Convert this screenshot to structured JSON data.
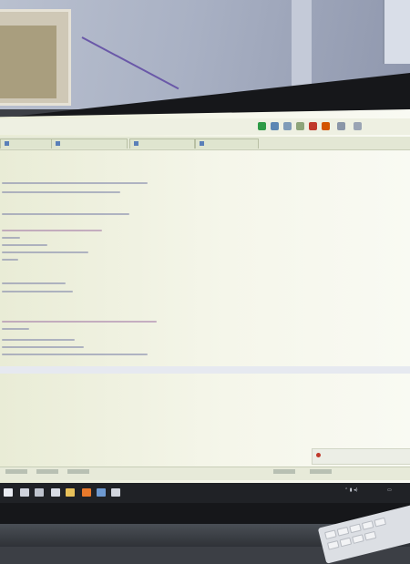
{
  "scene": {
    "description_colors": {
      "screen": "#f3f5e6",
      "bezel": "#16171a",
      "wall": "#aab2c5",
      "taskbar": "#202226"
    }
  },
  "editor": {
    "tabs": [
      {
        "icon": "java-file-icon"
      },
      {
        "icon": "java-file-icon"
      },
      {
        "icon": "java-file-icon"
      },
      {
        "icon": "java-file-icon"
      }
    ],
    "toolbar_icons": [
      "run-icon",
      "debug-icon",
      "build-icon",
      "stop-icon",
      "settings-icon",
      "search-icon"
    ]
  },
  "taskbar": {
    "icons": [
      "start-icon",
      "search-icon",
      "task-view-icon",
      "browser-icon",
      "folder-icon",
      "store-icon",
      "mail-icon",
      "ide-icon"
    ]
  }
}
